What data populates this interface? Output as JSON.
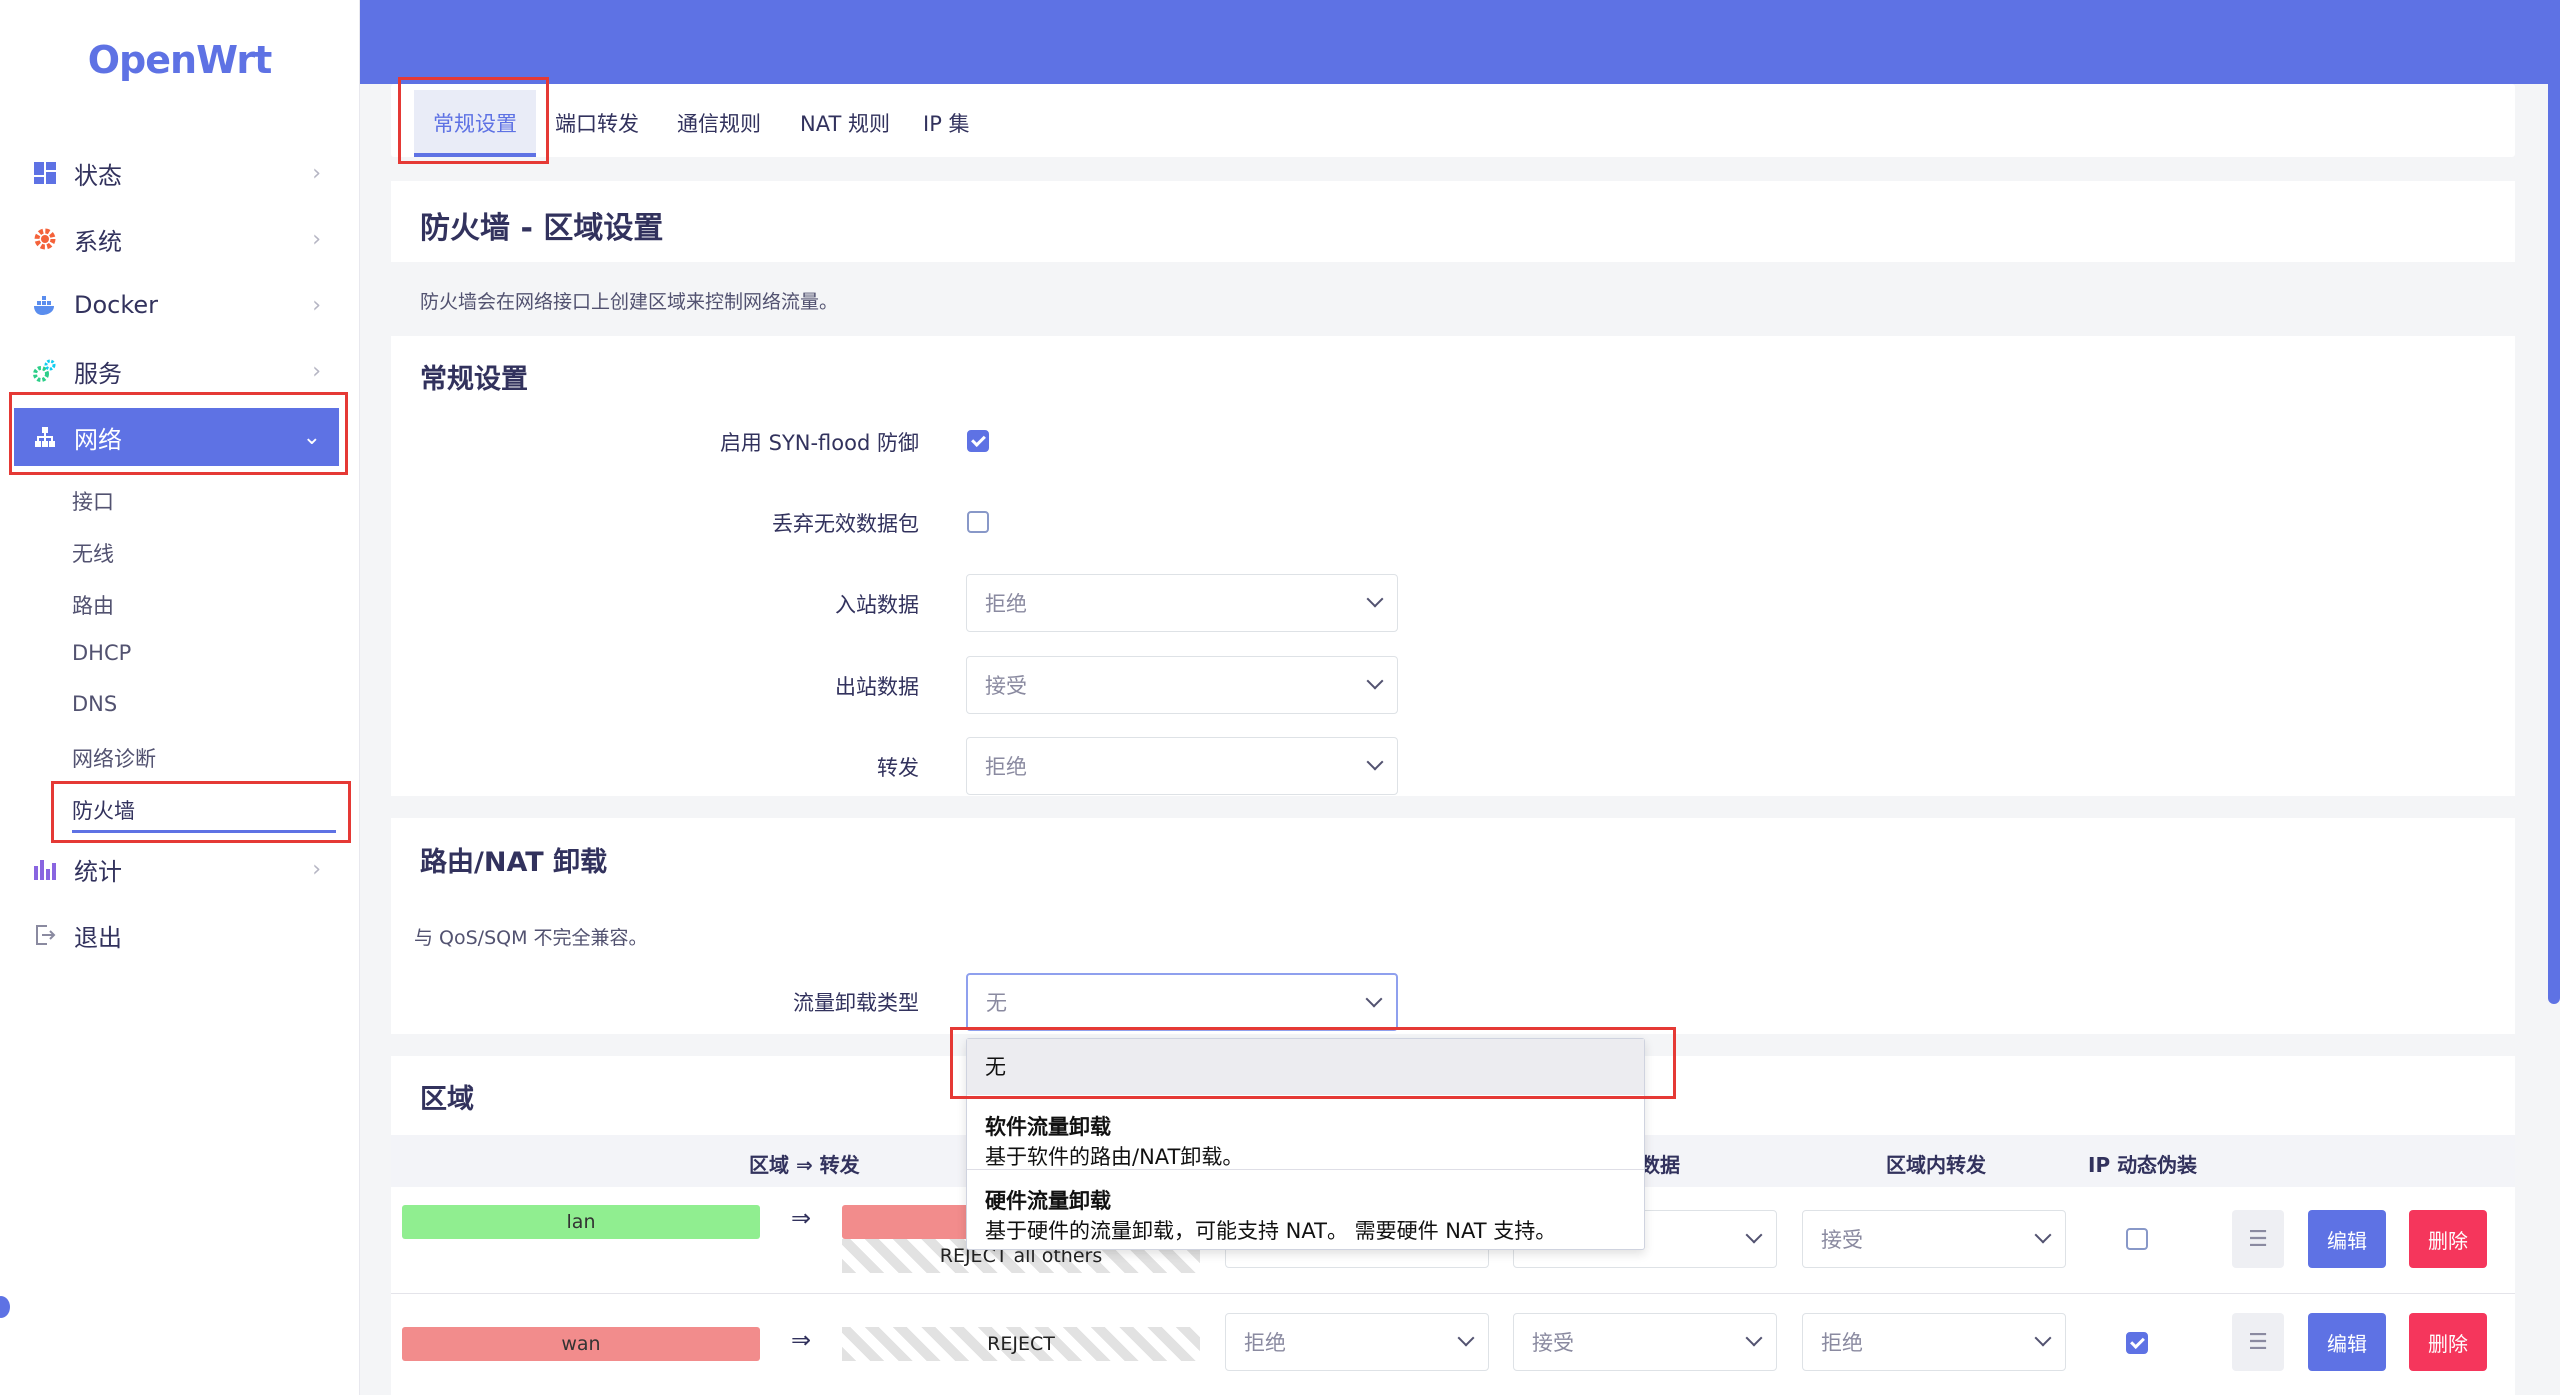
{
  "app": {
    "logo": "OpenWrt"
  },
  "sidebar": {
    "items": [
      {
        "label": "状态",
        "icon": "dashboard-icon"
      },
      {
        "label": "系统",
        "icon": "gear-icon"
      },
      {
        "label": "Docker",
        "icon": "docker-whale-icon"
      },
      {
        "label": "服务",
        "icon": "services-cogs-icon"
      },
      {
        "label": "网络",
        "icon": "network-sitemap-icon"
      },
      {
        "label": "统计",
        "icon": "bar-chart-icon"
      },
      {
        "label": "退出",
        "icon": "logout-icon"
      }
    ],
    "network_sub": [
      "接口",
      "无线",
      "路由",
      "DHCP",
      "DNS",
      "网络诊断",
      "防火墙"
    ],
    "accent": "#5e72e4"
  },
  "tabs": [
    "常规设置",
    "端口转发",
    "通信规则",
    "NAT 规则",
    "IP 集"
  ],
  "page": {
    "title": "防火墙 - 区域设置",
    "description": "防火墙会在网络接口上创建区域来控制网络流量。"
  },
  "general": {
    "title": "常规设置",
    "syn_flood_label": "启用 SYN-flood 防御",
    "syn_flood_checked": true,
    "drop_invalid_label": "丢弃无效数据包",
    "drop_invalid_checked": false,
    "input_label": "入站数据",
    "input_value": "拒绝",
    "output_label": "出站数据",
    "output_value": "接受",
    "forward_label": "转发",
    "forward_value": "拒绝"
  },
  "offload": {
    "title": "路由/NAT 卸载",
    "note": "与 QoS/SQM 不完全兼容。",
    "type_label": "流量卸载类型",
    "type_value": "无",
    "options": [
      {
        "title": "无",
        "desc": ""
      },
      {
        "title": "软件流量卸载",
        "desc": "基于软件的路由/NAT卸载。"
      },
      {
        "title": "硬件流量卸载",
        "desc": "基于硬件的流量卸载，可能支持 NAT。 需要硬件 NAT 支持。"
      }
    ]
  },
  "zones": {
    "title": "区域",
    "headers": {
      "zone_forward": "区域 ⇒ 转发",
      "data": "数据",
      "intra": "区域内转发",
      "masq": "IP 动态伪装"
    },
    "rows": [
      {
        "name": "lan",
        "arrow": "⇒",
        "target": "REJECT all others",
        "target_color": "#f28c8c",
        "color": "#90ee90",
        "input": "",
        "output": "",
        "forward": "接受",
        "masq": false
      },
      {
        "name": "wan",
        "arrow": "⇒",
        "target": "REJECT",
        "color": "#f28c8c",
        "input": "拒绝",
        "output": "接受",
        "forward": "拒绝",
        "masq": true
      }
    ],
    "edit_label": "编辑",
    "delete_label": "删除",
    "drag_label": "☰"
  }
}
